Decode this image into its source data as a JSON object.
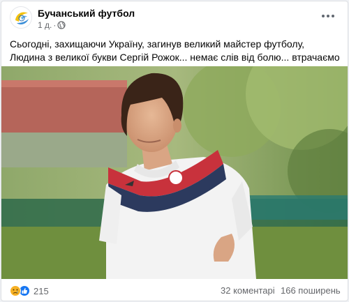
{
  "post": {
    "page_name": "Бучанський футбол",
    "time": "1 д.",
    "separator": "·",
    "privacy_icon": "globe-icon",
    "more_icon": "ellipsis-icon",
    "text": "Сьогодні, захищаючи Україну, загинув великий майстер футболу, Людина з великої букви Сергій Рожок... немає слів від болю... втрачаємо кращих..."
  },
  "footer": {
    "reaction_icons": [
      "sad-reaction-icon",
      "like-reaction-icon"
    ],
    "reaction_count": "215",
    "comments": "32 коментарі",
    "shares": "166 поширень"
  },
  "colors": {
    "like_blue": "#1877f2",
    "sad_yellow": "#f7b125",
    "secondary_text": "#65676b"
  }
}
